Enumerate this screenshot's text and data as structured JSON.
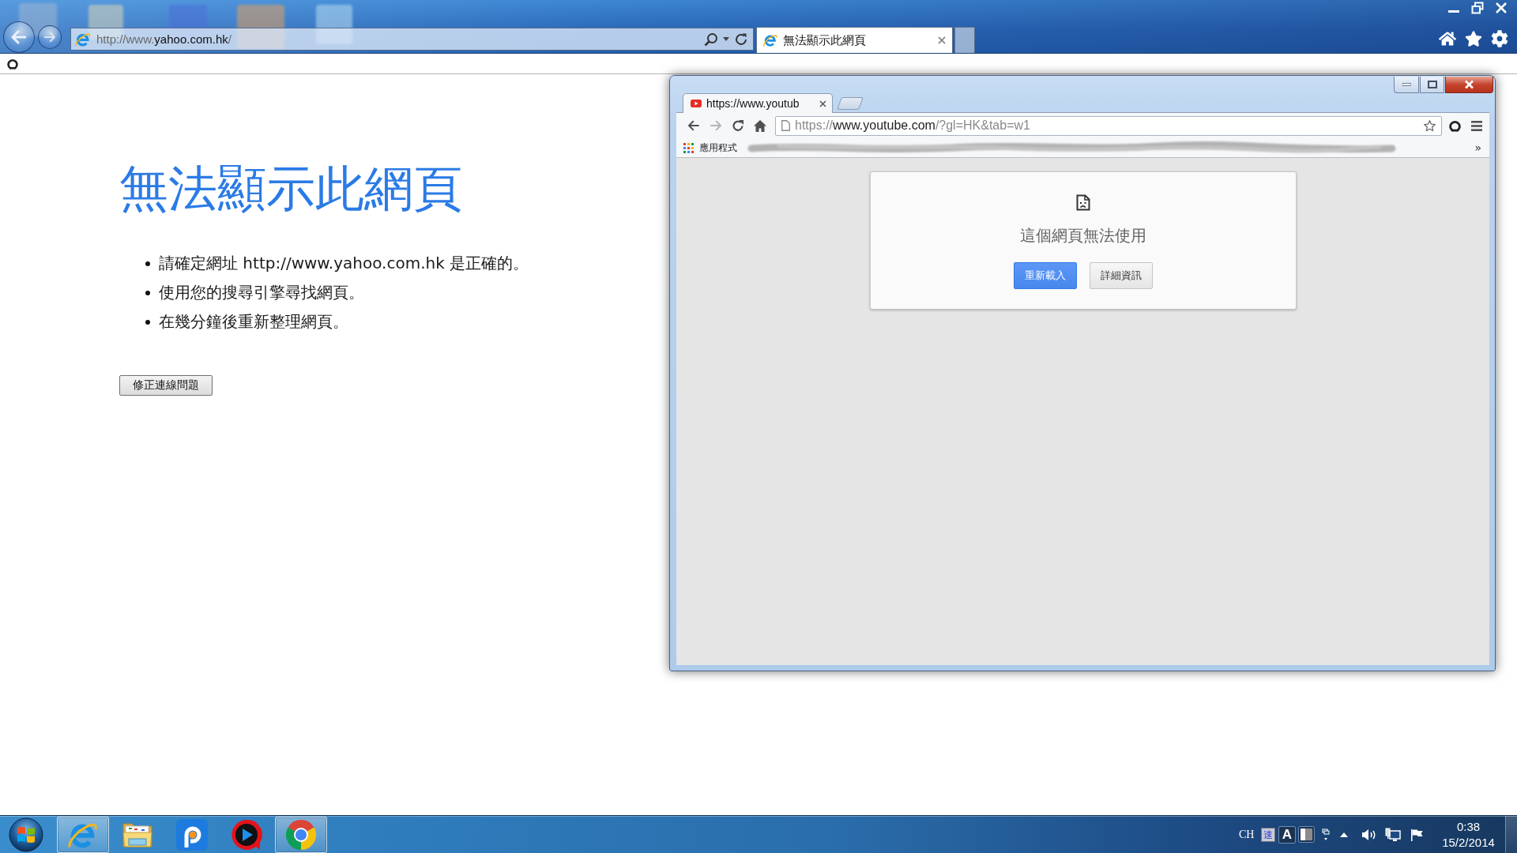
{
  "ie_window": {
    "address": {
      "before_domain": "http://www.",
      "domain": "yahoo.com.hk",
      "after_domain": "/"
    },
    "tabs": [
      {
        "title": "無法顯示此網頁",
        "selected": true
      }
    ],
    "page": {
      "heading": "無法顯示此網頁",
      "tips": [
        "請確定網址 http://www.yahoo.com.hk 是正確的。",
        "使用您的搜尋引擎尋找網頁。",
        "在幾分鐘後重新整理網頁。"
      ],
      "fix_button": "修正連線問題"
    }
  },
  "chrome_window": {
    "tabs": [
      {
        "title": "https://www.youtub",
        "selected": true
      }
    ],
    "omnibox": {
      "scheme": "https://",
      "host": "www.youtube.com",
      "path": "/?gl=HK&tab=w1"
    },
    "bookmarks_bar": {
      "apps_label": "應用程式",
      "overflow": "»"
    },
    "error_card": {
      "message": "這個網頁無法使用",
      "buttons": [
        {
          "label": "重新載入",
          "kind": "primary"
        },
        {
          "label": "詳細資訊",
          "kind": "secondary"
        }
      ]
    }
  },
  "taskbar": {
    "apps": [
      {
        "kind": "ie",
        "running": true
      },
      {
        "kind": "folder",
        "running": false
      },
      {
        "kind": "pptv",
        "running": false
      },
      {
        "kind": "player",
        "running": false
      },
      {
        "kind": "chrome",
        "running": true
      }
    ],
    "tray": {
      "language": "CH",
      "ime_glyph": "速",
      "ime_mode": "A",
      "time": "0:38",
      "date": "15/2/2014"
    }
  }
}
